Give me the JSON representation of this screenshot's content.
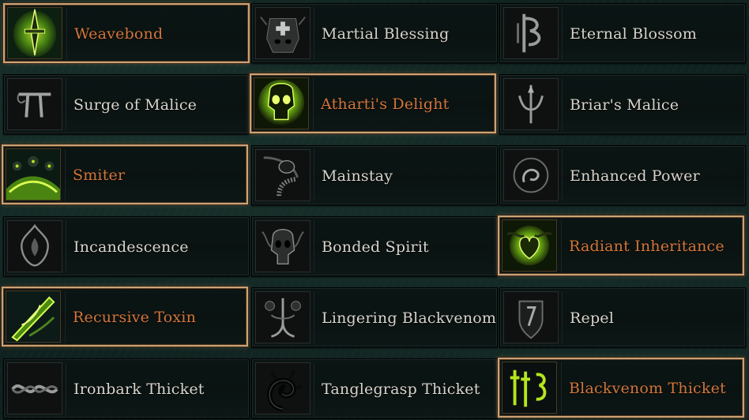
{
  "colors": {
    "selected_text": "#d2763b",
    "normal_text": "#d8d4cc",
    "selected_border": "#c9a477",
    "glow_green": "#b4e61e"
  },
  "talents": [
    {
      "label": "Weavebond",
      "selected": true,
      "icon": "glowing-sword-icon"
    },
    {
      "label": "Martial Blessing",
      "selected": false,
      "icon": "helmet-cross-icon"
    },
    {
      "label": "Eternal Blossom",
      "selected": false,
      "icon": "rune-glyph-icon"
    },
    {
      "label": "Surge of Malice",
      "selected": false,
      "icon": "pi-glyph-icon"
    },
    {
      "label": "Atharti's Delight",
      "selected": true,
      "icon": "glowing-skull-icon"
    },
    {
      "label": "Briar's Malice",
      "selected": false,
      "icon": "thorn-trident-icon"
    },
    {
      "label": "Smiter",
      "selected": true,
      "icon": "green-orbs-icon"
    },
    {
      "label": "Mainstay",
      "selected": false,
      "icon": "spiral-hook-icon"
    },
    {
      "label": "Enhanced Power",
      "selected": false,
      "icon": "swirl-orb-icon"
    },
    {
      "label": "Incandescence",
      "selected": false,
      "icon": "flame-sigil-icon"
    },
    {
      "label": "Bonded Spirit",
      "selected": false,
      "icon": "twin-skull-icon"
    },
    {
      "label": "Radiant Inheritance",
      "selected": true,
      "icon": "glowing-heart-thorns-icon"
    },
    {
      "label": "Recursive Toxin",
      "selected": true,
      "icon": "green-blade-icon"
    },
    {
      "label": "Lingering Blackvenom",
      "selected": false,
      "icon": "venom-faces-icon"
    },
    {
      "label": "Repel",
      "selected": false,
      "icon": "shield-rune-icon"
    },
    {
      "label": "Ironbark Thicket",
      "selected": false,
      "icon": "thorn-knot-icon"
    },
    {
      "label": "Tanglegrasp Thicket",
      "selected": false,
      "icon": "vine-spiral-icon"
    },
    {
      "label": "Blackvenom Thicket",
      "selected": true,
      "icon": "green-runes-icon"
    }
  ]
}
